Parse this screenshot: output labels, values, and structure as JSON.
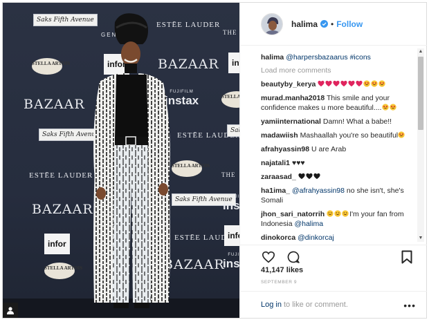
{
  "backdrop": {
    "harpers": "BAZAAR",
    "lauder": "ESTĒE LAUDER",
    "saks": "Saks Fifth Avenue",
    "stella": "STELLA ARTOIS",
    "instax": "instax",
    "instax_sub": "FUJIFILM",
    "infor": "infor",
    "the": "THE",
    "genesis": "GENESIS"
  },
  "header": {
    "username": "halima",
    "follow_label": "Follow",
    "separator": "•"
  },
  "caption": {
    "username": "halima",
    "mention": "@harpersbazaarus",
    "hashtag": "#icons"
  },
  "load_more": "Load more comments",
  "comments": [
    {
      "user": "beautyby_kerya",
      "text": "",
      "emoji": [
        "heart",
        "heart",
        "heart",
        "heart",
        "heart",
        "heart",
        "starstruck",
        "starstruck",
        "starstruck"
      ]
    },
    {
      "user": "murad.manha2018",
      "text": "This smile and your confidence makes u more beautiful....",
      "emoji": [
        "starstruck",
        "starstruck"
      ]
    },
    {
      "user": "yamiinternational",
      "text": "Damn! What a babe!!",
      "emoji": []
    },
    {
      "user": "madawiish",
      "text": "Mashaallah you're so beautiful",
      "emoji": [
        "starstruck"
      ]
    },
    {
      "user": "afrahyassin98",
      "text": "U are Arab",
      "emoji": []
    },
    {
      "user": "najatali1",
      "text": "♥♥♥",
      "emoji": []
    },
    {
      "user": "zaraasad_",
      "text": "",
      "emoji": [
        "blackheart",
        "blackheart",
        "blackheart"
      ]
    },
    {
      "user": "ha1ima_",
      "mention": "@afrahyassin98",
      "text": "no she isn't, she's Somali",
      "emoji": []
    },
    {
      "user": "jhon_sari_natorrih",
      "text": "I'm your fan from Indonesia",
      "mention_after": "@halima",
      "emoji": [
        "grin",
        "grin",
        "grin"
      ]
    },
    {
      "user": "dinokorca",
      "mention": "@dinkorcaj",
      "text": "",
      "emoji": []
    }
  ],
  "likes": "41,147 likes",
  "date": "SEPTEMBER 9",
  "login": {
    "link": "Log in",
    "rest": "to like or comment.",
    "more": "•••"
  },
  "icons": {
    "verified": "verified-badge-icon",
    "like": "heart-icon",
    "comment": "comment-icon",
    "save": "bookmark-icon",
    "user_tag": "user-tag-icon"
  },
  "colors": {
    "link_blue": "#3897f0",
    "mention_blue": "#003569",
    "muted_gray": "#999999",
    "heart_red": "#e0245e",
    "emoji_yellow": "#f7c533"
  }
}
